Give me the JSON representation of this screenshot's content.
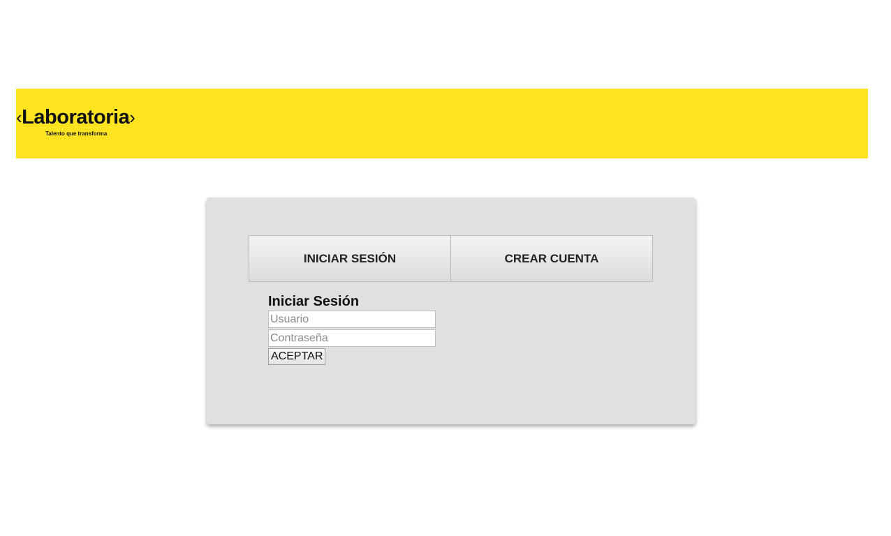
{
  "header": {
    "brand": {
      "bracket_left": "‹",
      "name": "Laboratoria",
      "bracket_right": "›",
      "tagline": "Talento que transforma"
    },
    "background_color": "#fde320"
  },
  "auth_card": {
    "tabs": [
      {
        "label": "INICIAR SESIÓN"
      },
      {
        "label": "CREAR CUENTA"
      }
    ],
    "login_form": {
      "title": "Iniciar Sesión",
      "username": {
        "value": "",
        "placeholder": "Usuario"
      },
      "password": {
        "value": "",
        "placeholder": "Contraseña"
      },
      "submit_label": "ACEPTAR"
    }
  }
}
